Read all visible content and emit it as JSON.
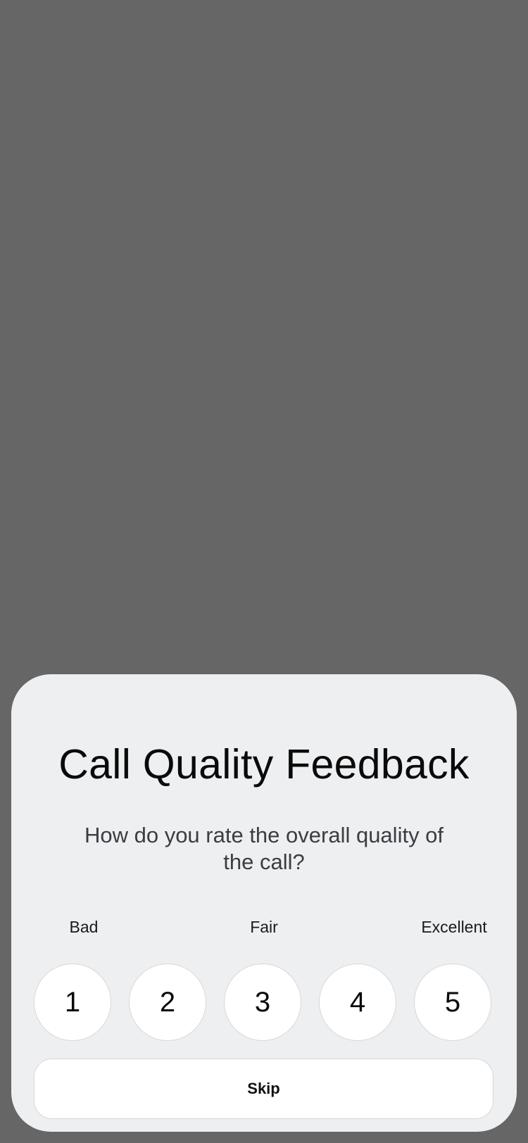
{
  "dialog": {
    "title": "Call Quality Feedback",
    "question": "How do you rate the overall quality of the call?",
    "scale_labels": {
      "low": "Bad",
      "mid": "Fair",
      "high": "Excellent"
    },
    "ratings": [
      "1",
      "2",
      "3",
      "4",
      "5"
    ],
    "skip_label": "Skip"
  },
  "colors": {
    "backdrop": "#666666",
    "sheet": "#eeeff1",
    "button_bg": "#ffffff",
    "text_primary": "#0a0a0a",
    "text_secondary": "#3c3c43"
  }
}
